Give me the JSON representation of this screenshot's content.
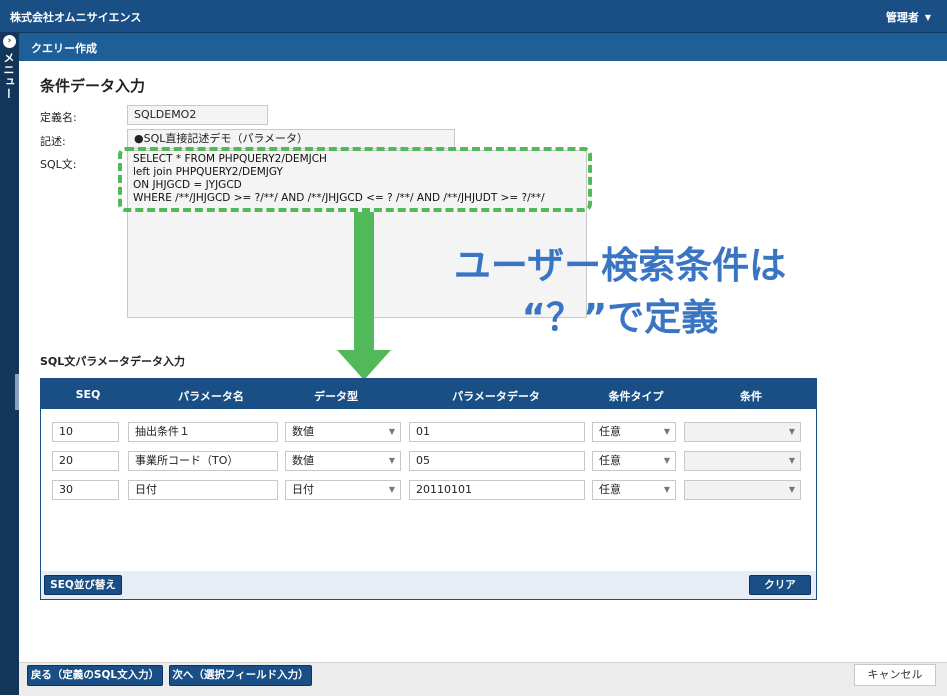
{
  "topbar": {
    "company": "株式会社オムニサイエンス",
    "admin_label": "管理者"
  },
  "menu_strip": {
    "label": "メニュー"
  },
  "subheader": {
    "title": "クエリー作成"
  },
  "main_title": "条件データ入力",
  "form": {
    "def_label": "定義名:",
    "def_value": "SQLDEMO2",
    "desc_label": "記述:",
    "desc_value": "●SQL直接記述デモ（パラメータ）",
    "sql_label": "SQL文:",
    "sql_lines": [
      "SELECT * FROM PHPQUERY2/DEMJCH",
      "left join PHPQUERY2/DEMJGY",
      "ON JHJGCD = JYJGCD",
      "WHERE /**/JHJGCD >= ?/**/ AND /**/JHJGCD <= ? /**/ AND /**/JHJUDT >= ?/**/"
    ]
  },
  "callout": {
    "line1": "ユーザー検索条件は",
    "line2": "“？”で定義"
  },
  "param_section": {
    "title": "SQL文パラメータデータ入力",
    "columns": [
      "SEQ",
      "パラメータ名",
      "データ型",
      "パラメータデータ",
      "条件タイプ",
      "条件"
    ],
    "rows": [
      {
        "seq": "10",
        "name": "抽出条件１",
        "type": "数値",
        "data": "01",
        "cond_type": "任意",
        "cond": ""
      },
      {
        "seq": "20",
        "name": "事業所コード（TO）",
        "type": "数値",
        "data": "05",
        "cond_type": "任意",
        "cond": ""
      },
      {
        "seq": "30",
        "name": "日付",
        "type": "日付",
        "data": "20110101",
        "cond_type": "任意",
        "cond": ""
      }
    ],
    "sort_button": "SEQ並び替え",
    "clear_button": "クリア"
  },
  "footer": {
    "back_button": "戻る（定義のSQL文入力）",
    "next_button": "次へ（選択フィールド入力）",
    "cancel_button": "キャンセル"
  },
  "colors": {
    "primary": "#1a4f86",
    "accent_green": "#52b95a",
    "callout_blue": "#3a75c4"
  }
}
